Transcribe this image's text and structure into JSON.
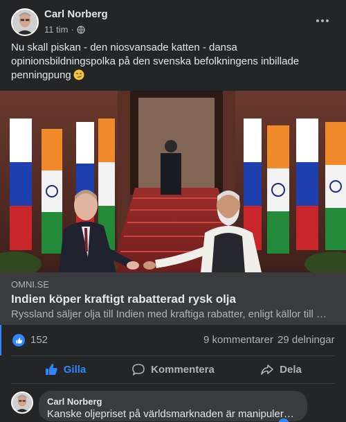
{
  "post": {
    "author": "Carl Norberg",
    "time": "11 tim",
    "separator": "·",
    "audience_icon": "globe-icon",
    "more_icon": "more-options-icon",
    "text": "Nu skall piskan - den niosvansade katten - dansa opinionsbildningspolka på den svenska befolkningens inbillade penningpung",
    "text_emoji": "smirk-face-emoji"
  },
  "link": {
    "domain": "OMNI.SE",
    "title": "Indien köper kraftigt rabatterad rysk olja",
    "description": "Ryssland säljer olja till Indien med kraftiga rabatter, enligt källor till …"
  },
  "stats": {
    "likes": "152",
    "comments": "9 kommentarer",
    "shares": "29 delningar"
  },
  "actions": {
    "like": "Gilla",
    "comment": "Kommentera",
    "share": "Dela"
  },
  "comment": {
    "author": "Carl Norberg",
    "text": "Kanske oljepriset på världsmarknaden är manipulerat..."
  },
  "colors": {
    "background": "#242526",
    "accent": "#2d88ff",
    "text_primary": "#e4e6eb",
    "text_secondary": "#b0b3b8",
    "preview_bg": "#3a3b3c"
  }
}
